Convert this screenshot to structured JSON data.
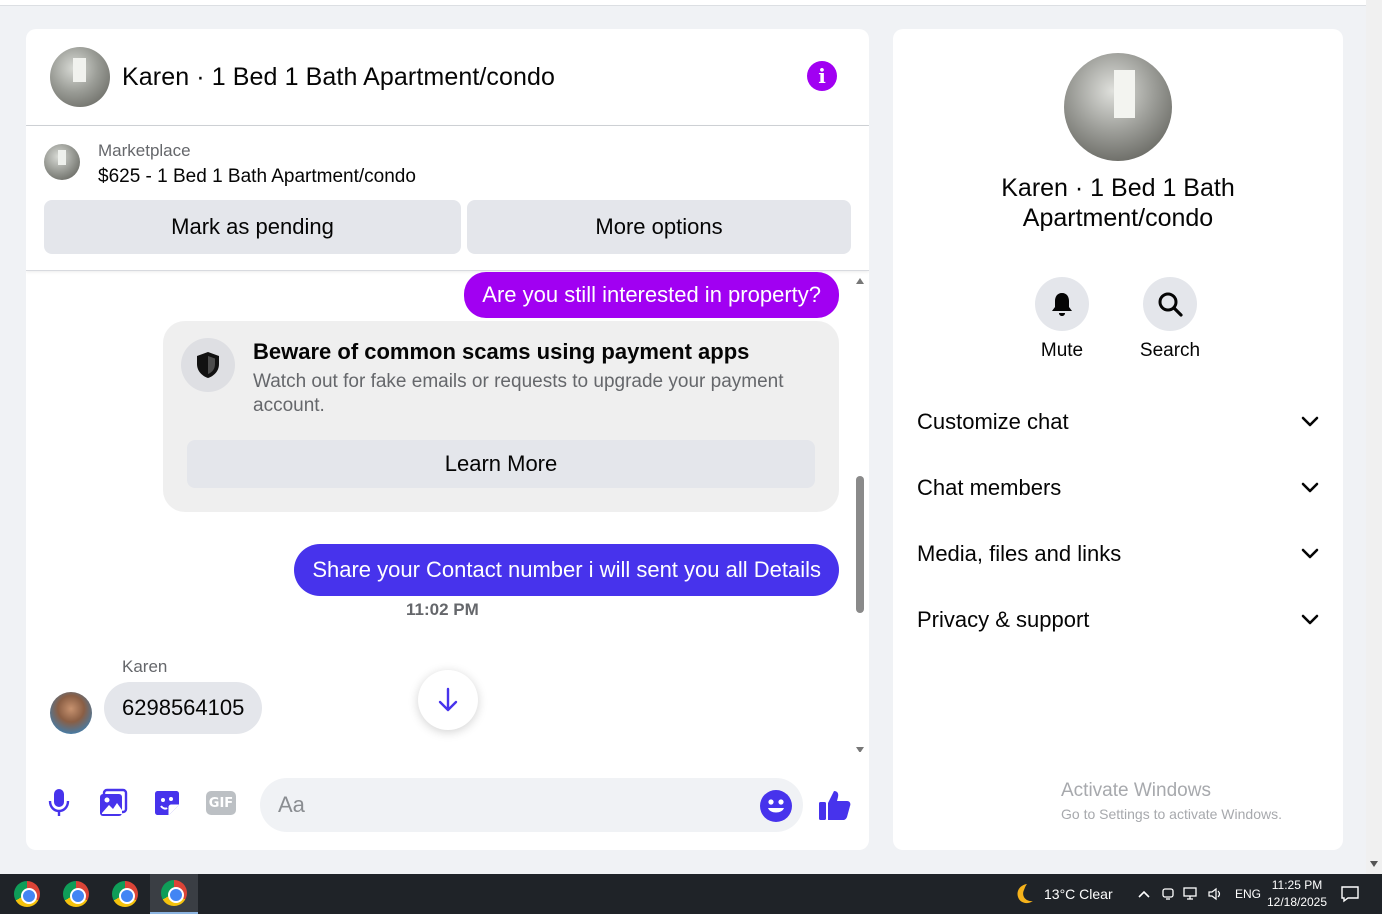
{
  "chat": {
    "title": "Karen · 1 Bed 1 Bath Apartment/condo",
    "info_icon": "info-icon",
    "listing": {
      "source": "Marketplace",
      "price_title": "$625 - 1 Bed 1 Bath Apartment/condo",
      "mark_pending_label": "Mark as pending",
      "more_options_label": "More options"
    },
    "messages": {
      "outgoing_1": "Are you still interested in property?",
      "warning": {
        "title": "Beware of common scams using payment apps",
        "body": "Watch out for fake emails or requests to upgrade your payment account.",
        "learn_more_label": "Learn More"
      },
      "outgoing_2": "Share your Contact number i will sent you all Details",
      "timestamp": "11:02 PM",
      "sender_name": "Karen",
      "incoming_1": "6298564105"
    },
    "composer": {
      "placeholder": "Aa",
      "icons": [
        "microphone-icon",
        "image-icon",
        "sticker-icon",
        "gif-icon",
        "emoji-icon",
        "thumbs-up-icon"
      ],
      "gif_label": "GIF"
    },
    "colors": {
      "accent_purple": "#a100f2",
      "accent_blue": "#4733ec"
    }
  },
  "side": {
    "name": "Karen · 1 Bed 1 Bath Apartment/condo",
    "actions": [
      {
        "label": "Mute",
        "icon": "bell-icon"
      },
      {
        "label": "Search",
        "icon": "search-icon"
      }
    ],
    "sections": [
      {
        "label": "Customize chat"
      },
      {
        "label": "Chat members"
      },
      {
        "label": "Media, files and links"
      },
      {
        "label": "Privacy & support"
      }
    ],
    "activate_title": "Activate Windows",
    "activate_sub": "Go to Settings to activate Windows."
  },
  "taskbar": {
    "apps": [
      "chrome-icon",
      "chrome-icon",
      "chrome-icon",
      "chrome-icon"
    ],
    "weather": "13°C  Clear",
    "weather_icon": "moon-icon",
    "language": "ENG",
    "time": "11:25 PM",
    "date": "12/18/2025"
  }
}
